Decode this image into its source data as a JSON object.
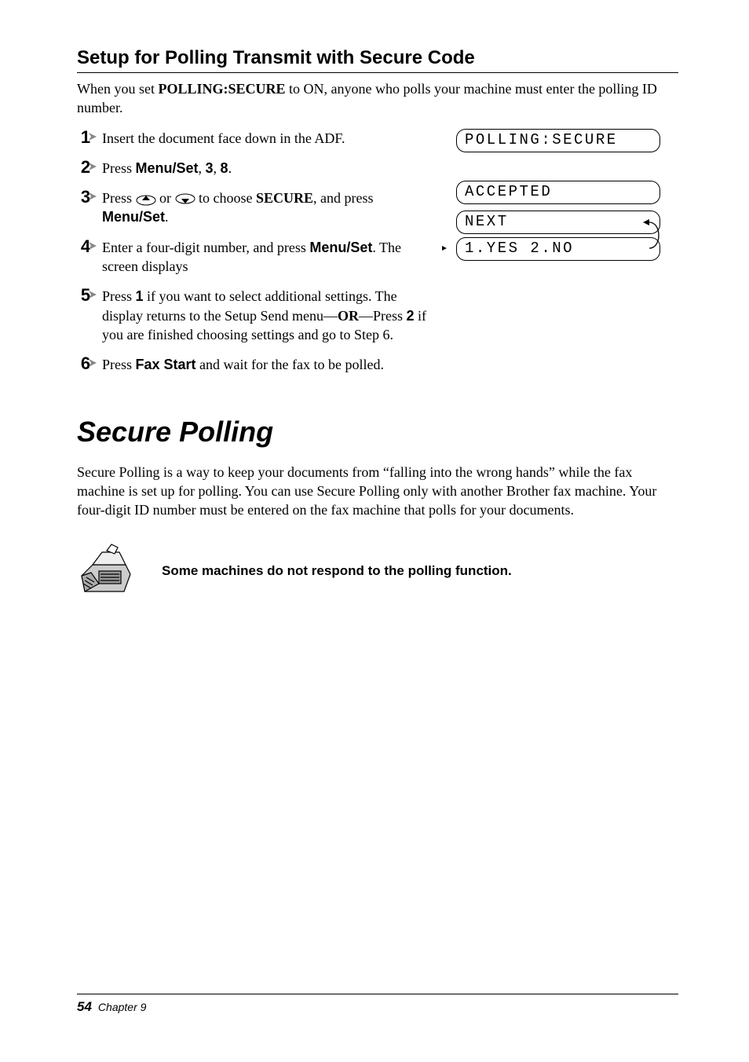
{
  "section_heading": "Setup for Polling Transmit with Secure Code",
  "intro": {
    "pre": "When you set ",
    "bold": "POLLING:SECURE",
    "post": " to ON, anyone who polls your machine must enter the polling ID number."
  },
  "steps": {
    "s1": {
      "num": "1",
      "text": "Insert the document face down in the ADF."
    },
    "s2": {
      "num": "2",
      "pre": "Press ",
      "b1": "Menu/Set",
      "c1": ", ",
      "b2": "3",
      "c2": ", ",
      "b3": "8",
      "post": "."
    },
    "s3": {
      "num": "3",
      "pre": "Press ",
      "mid": " or ",
      "mid2": " to choose ",
      "bold1": "SECURE",
      "mid3": ", and press ",
      "bold2": "Menu/Set",
      "post": "."
    },
    "s4": {
      "num": "4",
      "pre": "Enter a four-digit number, and press ",
      "bold": "Menu/Set",
      "post": ". The screen displays"
    },
    "s5": {
      "num": "5",
      "pre": "Press ",
      "bold1": "1",
      "mid1": " if you want to select additional settings. The display returns to the Setup Send menu—",
      "boldor": "OR",
      "mid2": "—Press ",
      "bold2": "2",
      "post": " if you are finished choosing settings and go to Step 6."
    },
    "s6": {
      "num": "6",
      "pre": "Press ",
      "bold": "Fax Start",
      "post": " and wait for the fax to be polled."
    }
  },
  "lcd": {
    "d1": "POLLING:SECURE",
    "d2": "ACCEPTED",
    "d3": "NEXT",
    "d4": "1.YES 2.NO"
  },
  "main_heading": "Secure Polling",
  "body_para": "Secure Polling is a way to keep your documents from “falling into the wrong hands” while the fax machine is set up for polling. You can use Secure Polling only with another Brother fax machine. Your four-digit ID number must be entered on the fax machine that polls for your documents.",
  "note_text": "Some machines do not respond to the polling function.",
  "footer": {
    "pagenum": "54",
    "chapter": "Chapter 9"
  }
}
